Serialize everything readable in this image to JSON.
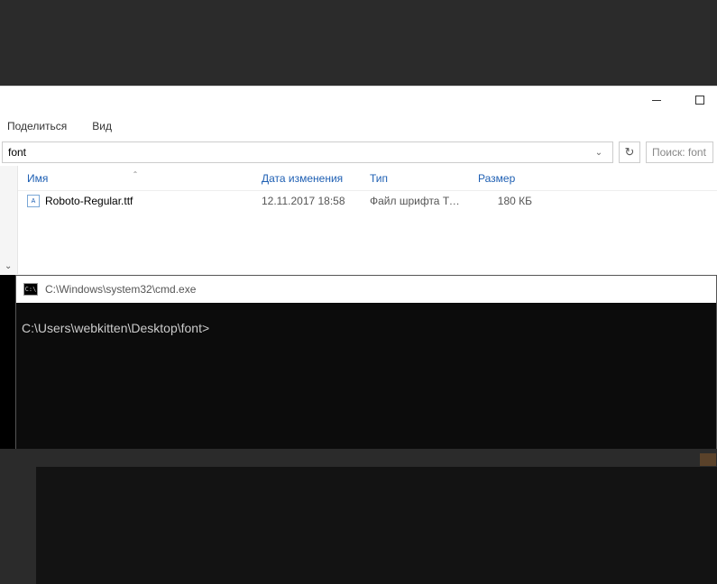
{
  "explorer": {
    "ribbon": {
      "share": "Поделиться",
      "view": "Вид"
    },
    "address": {
      "path": "font",
      "search_placeholder": "Поиск: font"
    },
    "columns": {
      "name": "Имя",
      "date": "Дата изменения",
      "type": "Тип",
      "size": "Размер"
    },
    "files": [
      {
        "name": "Roboto-Regular.ttf",
        "date": "12.11.2017 18:58",
        "type": "Файл шрифта Tru...",
        "size": "180 КБ"
      }
    ]
  },
  "cmd": {
    "title": "C:\\Windows\\system32\\cmd.exe",
    "icon_text": "C:\\",
    "prompt": "C:\\Users\\webkitten\\Desktop\\font>"
  }
}
